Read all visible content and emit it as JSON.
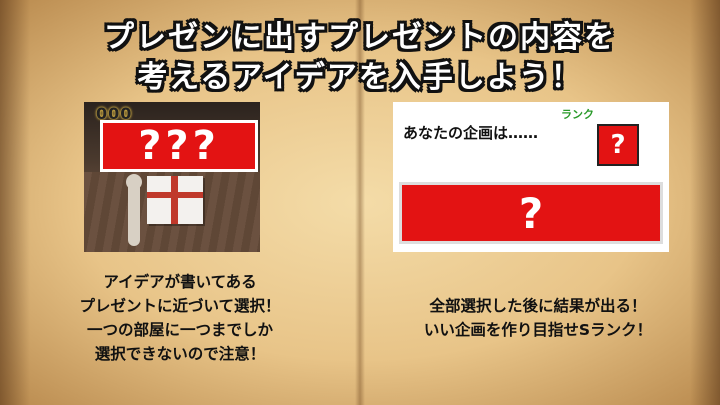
{
  "title": {
    "line1": "プレゼンに出すプレゼントの内容を",
    "line2": "考えるアイデアを入手しよう！"
  },
  "left_page": {
    "coins": "000",
    "question_box": "???",
    "description": [
      "アイデアが書いてある",
      "プレゼントに近づいて選択！",
      "一つの部屋に一つまでしか",
      "選択できないので注意！"
    ]
  },
  "right_page": {
    "plan_text": "あなたの企画は……",
    "rank_label": "ランク",
    "rank_value": "?",
    "result_value": "?",
    "description": [
      "全部選択した後に結果が出る！",
      "いい企画を作り目指せSランク！"
    ]
  },
  "colors": {
    "accent_red": "#e31313",
    "rank_green": "#2a9a2a",
    "page": "#f4dca8"
  }
}
